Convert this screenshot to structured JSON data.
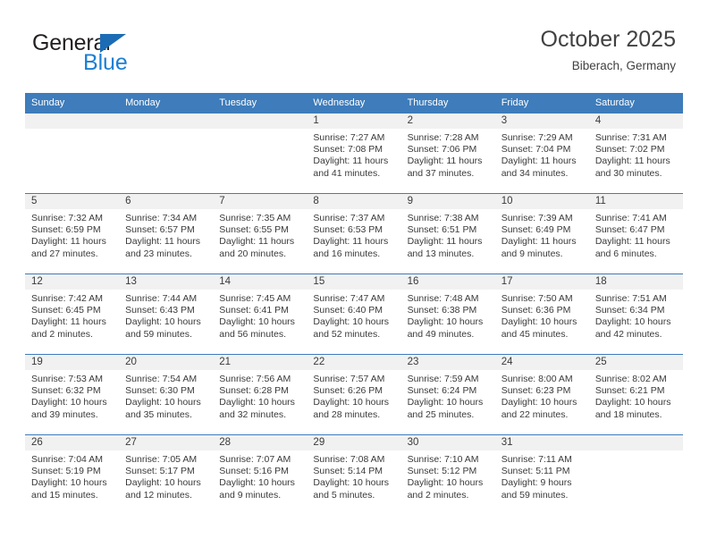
{
  "brand": {
    "name_top": "General",
    "name_bottom": "Blue",
    "triangle_icon": "blue-triangle-icon",
    "color_top": "#231f20",
    "color_bottom": "#1b7fd4"
  },
  "header": {
    "title": "October 2025",
    "subtitle": "Biberach, Germany"
  },
  "theme": {
    "header_bg": "#3e7cbb",
    "header_text": "#ffffff",
    "daynum_band_bg": "#f1f1f1",
    "row_border": "#3e7cbb",
    "body_text": "#3a3a3a"
  },
  "weekday_headers": [
    "Sunday",
    "Monday",
    "Tuesday",
    "Wednesday",
    "Thursday",
    "Friday",
    "Saturday"
  ],
  "labels": {
    "sunrise_prefix": "Sunrise:",
    "sunset_prefix": "Sunset:",
    "daylight_prefix": "Daylight:"
  },
  "weeks": [
    [
      {
        "day": "",
        "empty": true,
        "sunrise": "",
        "sunset": "",
        "daylight_line1": "",
        "daylight_line2": ""
      },
      {
        "day": "",
        "empty": true,
        "sunrise": "",
        "sunset": "",
        "daylight_line1": "",
        "daylight_line2": ""
      },
      {
        "day": "",
        "empty": true,
        "sunrise": "",
        "sunset": "",
        "daylight_line1": "",
        "daylight_line2": ""
      },
      {
        "day": "1",
        "empty": false,
        "sunrise": "Sunrise: 7:27 AM",
        "sunset": "Sunset: 7:08 PM",
        "daylight_line1": "Daylight: 11 hours",
        "daylight_line2": "and 41 minutes."
      },
      {
        "day": "2",
        "empty": false,
        "sunrise": "Sunrise: 7:28 AM",
        "sunset": "Sunset: 7:06 PM",
        "daylight_line1": "Daylight: 11 hours",
        "daylight_line2": "and 37 minutes."
      },
      {
        "day": "3",
        "empty": false,
        "sunrise": "Sunrise: 7:29 AM",
        "sunset": "Sunset: 7:04 PM",
        "daylight_line1": "Daylight: 11 hours",
        "daylight_line2": "and 34 minutes."
      },
      {
        "day": "4",
        "empty": false,
        "sunrise": "Sunrise: 7:31 AM",
        "sunset": "Sunset: 7:02 PM",
        "daylight_line1": "Daylight: 11 hours",
        "daylight_line2": "and 30 minutes."
      }
    ],
    [
      {
        "day": "5",
        "empty": false,
        "sunrise": "Sunrise: 7:32 AM",
        "sunset": "Sunset: 6:59 PM",
        "daylight_line1": "Daylight: 11 hours",
        "daylight_line2": "and 27 minutes."
      },
      {
        "day": "6",
        "empty": false,
        "sunrise": "Sunrise: 7:34 AM",
        "sunset": "Sunset: 6:57 PM",
        "daylight_line1": "Daylight: 11 hours",
        "daylight_line2": "and 23 minutes."
      },
      {
        "day": "7",
        "empty": false,
        "sunrise": "Sunrise: 7:35 AM",
        "sunset": "Sunset: 6:55 PM",
        "daylight_line1": "Daylight: 11 hours",
        "daylight_line2": "and 20 minutes."
      },
      {
        "day": "8",
        "empty": false,
        "sunrise": "Sunrise: 7:37 AM",
        "sunset": "Sunset: 6:53 PM",
        "daylight_line1": "Daylight: 11 hours",
        "daylight_line2": "and 16 minutes."
      },
      {
        "day": "9",
        "empty": false,
        "sunrise": "Sunrise: 7:38 AM",
        "sunset": "Sunset: 6:51 PM",
        "daylight_line1": "Daylight: 11 hours",
        "daylight_line2": "and 13 minutes."
      },
      {
        "day": "10",
        "empty": false,
        "sunrise": "Sunrise: 7:39 AM",
        "sunset": "Sunset: 6:49 PM",
        "daylight_line1": "Daylight: 11 hours",
        "daylight_line2": "and 9 minutes."
      },
      {
        "day": "11",
        "empty": false,
        "sunrise": "Sunrise: 7:41 AM",
        "sunset": "Sunset: 6:47 PM",
        "daylight_line1": "Daylight: 11 hours",
        "daylight_line2": "and 6 minutes."
      }
    ],
    [
      {
        "day": "12",
        "empty": false,
        "sunrise": "Sunrise: 7:42 AM",
        "sunset": "Sunset: 6:45 PM",
        "daylight_line1": "Daylight: 11 hours",
        "daylight_line2": "and 2 minutes."
      },
      {
        "day": "13",
        "empty": false,
        "sunrise": "Sunrise: 7:44 AM",
        "sunset": "Sunset: 6:43 PM",
        "daylight_line1": "Daylight: 10 hours",
        "daylight_line2": "and 59 minutes."
      },
      {
        "day": "14",
        "empty": false,
        "sunrise": "Sunrise: 7:45 AM",
        "sunset": "Sunset: 6:41 PM",
        "daylight_line1": "Daylight: 10 hours",
        "daylight_line2": "and 56 minutes."
      },
      {
        "day": "15",
        "empty": false,
        "sunrise": "Sunrise: 7:47 AM",
        "sunset": "Sunset: 6:40 PM",
        "daylight_line1": "Daylight: 10 hours",
        "daylight_line2": "and 52 minutes."
      },
      {
        "day": "16",
        "empty": false,
        "sunrise": "Sunrise: 7:48 AM",
        "sunset": "Sunset: 6:38 PM",
        "daylight_line1": "Daylight: 10 hours",
        "daylight_line2": "and 49 minutes."
      },
      {
        "day": "17",
        "empty": false,
        "sunrise": "Sunrise: 7:50 AM",
        "sunset": "Sunset: 6:36 PM",
        "daylight_line1": "Daylight: 10 hours",
        "daylight_line2": "and 45 minutes."
      },
      {
        "day": "18",
        "empty": false,
        "sunrise": "Sunrise: 7:51 AM",
        "sunset": "Sunset: 6:34 PM",
        "daylight_line1": "Daylight: 10 hours",
        "daylight_line2": "and 42 minutes."
      }
    ],
    [
      {
        "day": "19",
        "empty": false,
        "sunrise": "Sunrise: 7:53 AM",
        "sunset": "Sunset: 6:32 PM",
        "daylight_line1": "Daylight: 10 hours",
        "daylight_line2": "and 39 minutes."
      },
      {
        "day": "20",
        "empty": false,
        "sunrise": "Sunrise: 7:54 AM",
        "sunset": "Sunset: 6:30 PM",
        "daylight_line1": "Daylight: 10 hours",
        "daylight_line2": "and 35 minutes."
      },
      {
        "day": "21",
        "empty": false,
        "sunrise": "Sunrise: 7:56 AM",
        "sunset": "Sunset: 6:28 PM",
        "daylight_line1": "Daylight: 10 hours",
        "daylight_line2": "and 32 minutes."
      },
      {
        "day": "22",
        "empty": false,
        "sunrise": "Sunrise: 7:57 AM",
        "sunset": "Sunset: 6:26 PM",
        "daylight_line1": "Daylight: 10 hours",
        "daylight_line2": "and 28 minutes."
      },
      {
        "day": "23",
        "empty": false,
        "sunrise": "Sunrise: 7:59 AM",
        "sunset": "Sunset: 6:24 PM",
        "daylight_line1": "Daylight: 10 hours",
        "daylight_line2": "and 25 minutes."
      },
      {
        "day": "24",
        "empty": false,
        "sunrise": "Sunrise: 8:00 AM",
        "sunset": "Sunset: 6:23 PM",
        "daylight_line1": "Daylight: 10 hours",
        "daylight_line2": "and 22 minutes."
      },
      {
        "day": "25",
        "empty": false,
        "sunrise": "Sunrise: 8:02 AM",
        "sunset": "Sunset: 6:21 PM",
        "daylight_line1": "Daylight: 10 hours",
        "daylight_line2": "and 18 minutes."
      }
    ],
    [
      {
        "day": "26",
        "empty": false,
        "sunrise": "Sunrise: 7:04 AM",
        "sunset": "Sunset: 5:19 PM",
        "daylight_line1": "Daylight: 10 hours",
        "daylight_line2": "and 15 minutes."
      },
      {
        "day": "27",
        "empty": false,
        "sunrise": "Sunrise: 7:05 AM",
        "sunset": "Sunset: 5:17 PM",
        "daylight_line1": "Daylight: 10 hours",
        "daylight_line2": "and 12 minutes."
      },
      {
        "day": "28",
        "empty": false,
        "sunrise": "Sunrise: 7:07 AM",
        "sunset": "Sunset: 5:16 PM",
        "daylight_line1": "Daylight: 10 hours",
        "daylight_line2": "and 9 minutes."
      },
      {
        "day": "29",
        "empty": false,
        "sunrise": "Sunrise: 7:08 AM",
        "sunset": "Sunset: 5:14 PM",
        "daylight_line1": "Daylight: 10 hours",
        "daylight_line2": "and 5 minutes."
      },
      {
        "day": "30",
        "empty": false,
        "sunrise": "Sunrise: 7:10 AM",
        "sunset": "Sunset: 5:12 PM",
        "daylight_line1": "Daylight: 10 hours",
        "daylight_line2": "and 2 minutes."
      },
      {
        "day": "31",
        "empty": false,
        "sunrise": "Sunrise: 7:11 AM",
        "sunset": "Sunset: 5:11 PM",
        "daylight_line1": "Daylight: 9 hours",
        "daylight_line2": "and 59 minutes."
      },
      {
        "day": "",
        "empty": true,
        "sunrise": "",
        "sunset": "",
        "daylight_line1": "",
        "daylight_line2": ""
      }
    ]
  ]
}
